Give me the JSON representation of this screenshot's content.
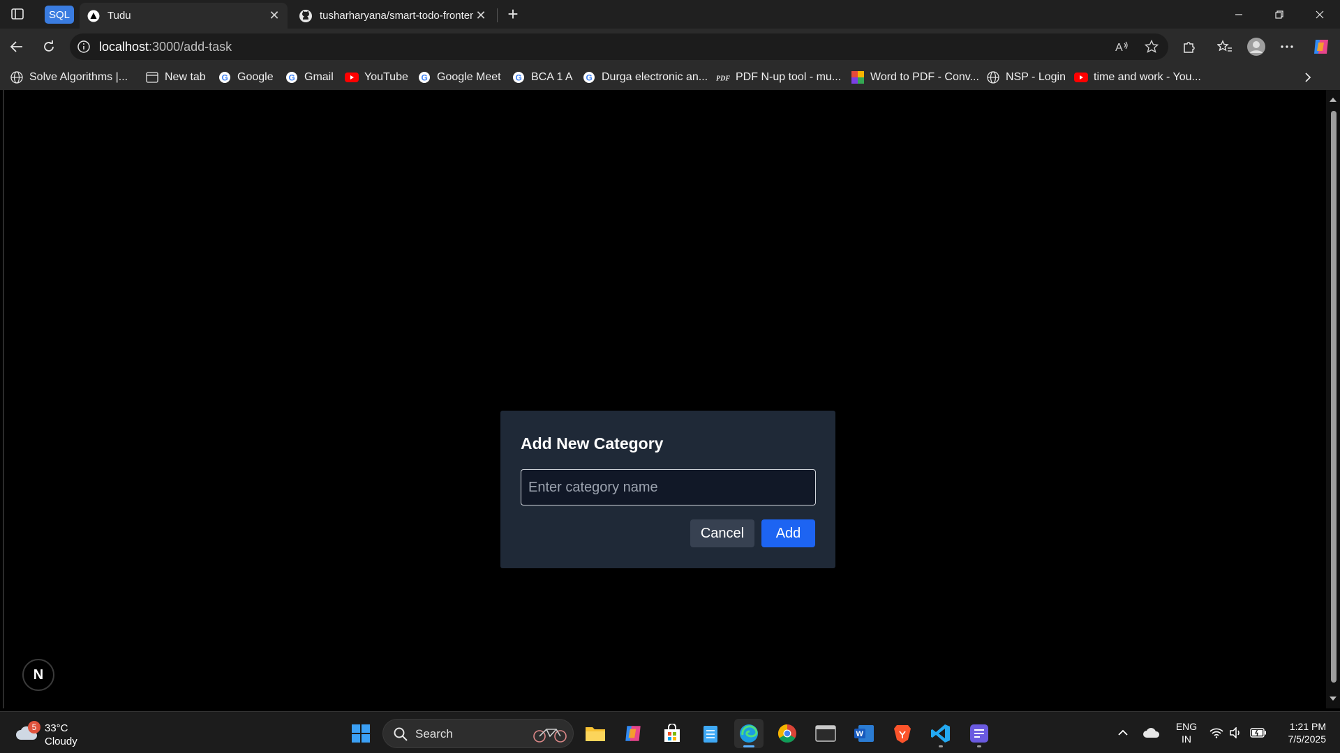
{
  "browser": {
    "tabs": [
      {
        "label": "SQL",
        "kind": "group"
      },
      {
        "label": "Tudu",
        "active": true
      },
      {
        "label": "tusharharyana/smart-todo-frontend",
        "active": false
      }
    ],
    "address": {
      "host": "localhost",
      "path": ":3000/add-task"
    },
    "bookmarks": [
      {
        "label": "Solve Algorithms |...",
        "icon": "globe-icon"
      },
      {
        "label": "New tab",
        "icon": "newtab-icon"
      },
      {
        "label": "Google",
        "icon": "google-icon"
      },
      {
        "label": "Gmail",
        "icon": "google-icon"
      },
      {
        "label": "YouTube",
        "icon": "youtube-icon"
      },
      {
        "label": "Google Meet",
        "icon": "google-icon"
      },
      {
        "label": "BCA 1 A",
        "icon": "google-icon"
      },
      {
        "label": "Durga electronic an...",
        "icon": "google-icon"
      },
      {
        "label": "PDF N-up tool - mu...",
        "icon": "pdf-icon"
      },
      {
        "label": "Word to PDF - Conv...",
        "icon": "ilovepdf-icon"
      },
      {
        "label": "NSP - Login",
        "icon": "globe-icon"
      },
      {
        "label": "time and work - You...",
        "icon": "youtube-icon"
      }
    ]
  },
  "page": {
    "modal": {
      "title": "Add New Category",
      "input_placeholder": "Enter category name",
      "input_value": "",
      "cancel_label": "Cancel",
      "add_label": "Add"
    },
    "next_badge": "N"
  },
  "taskbar": {
    "weather": {
      "temp": "33°C",
      "condition": "Cloudy",
      "badge": "5"
    },
    "search_label": "Search",
    "lang_line1": "ENG",
    "lang_line2": "IN",
    "time": "1:21 PM",
    "date": "7/5/2025"
  },
  "colors": {
    "modal_bg": "#1f2937",
    "add_button": "#1d64f2",
    "cancel_button": "#374151",
    "page_bg": "#000000"
  }
}
